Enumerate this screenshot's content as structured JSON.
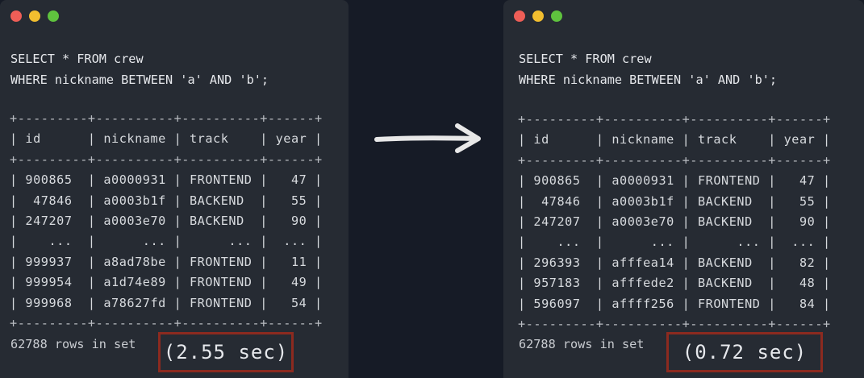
{
  "left_window": {
    "query_line1": "SELECT * FROM crew",
    "query_line2": "WHERE nickname BETWEEN 'a' AND 'b';",
    "border_line": "+---------+----------+----------+------+",
    "header_row": "| id      | nickname | track    | year |",
    "rows": [
      "| 900865  | a0000931 | FRONTEND |   47 |",
      "|  47846  | a0003b1f | BACKEND  |   55 |",
      "| 247207  | a0003e70 | BACKEND  |   90 |",
      "|    ...  |      ... |      ... |  ... |",
      "| 999937  | a8ad78be | FRONTEND |   11 |",
      "| 999954  | a1d74e89 | FRONTEND |   49 |",
      "| 999968  | a78627fd | FRONTEND |   54 |"
    ],
    "rows_in_set": "62788 rows in set",
    "time": "(2.55 sec)"
  },
  "right_window": {
    "query_line1": "SELECT * FROM crew",
    "query_line2": "WHERE nickname BETWEEN 'a' AND 'b';",
    "border_line": "+---------+----------+----------+------+",
    "header_row": "| id      | nickname | track    | year |",
    "rows": [
      "| 900865  | a0000931 | FRONTEND |   47 |",
      "|  47846  | a0003b1f | BACKEND  |   55 |",
      "| 247207  | a0003e70 | BACKEND  |   90 |",
      "|    ...  |      ... |      ... |  ... |",
      "| 296393  | afffea14 | BACKEND  |   82 |",
      "| 957183  | afffede2 | BACKEND  |   48 |",
      "| 596097  | affff256 | FRONTEND |   84 |"
    ],
    "rows_in_set": "62788 rows in set",
    "time": "(0.72 sec)"
  },
  "colors": {
    "background": "#161b26",
    "window": "#262b33",
    "highlight_box": "#8c2a1f",
    "traffic_red": "#ee5e57",
    "traffic_yellow": "#f2be2f",
    "traffic_green": "#5fc33e",
    "arrow": "#e8e8e8"
  },
  "icons": {
    "arrow": "arrow-right-icon"
  }
}
